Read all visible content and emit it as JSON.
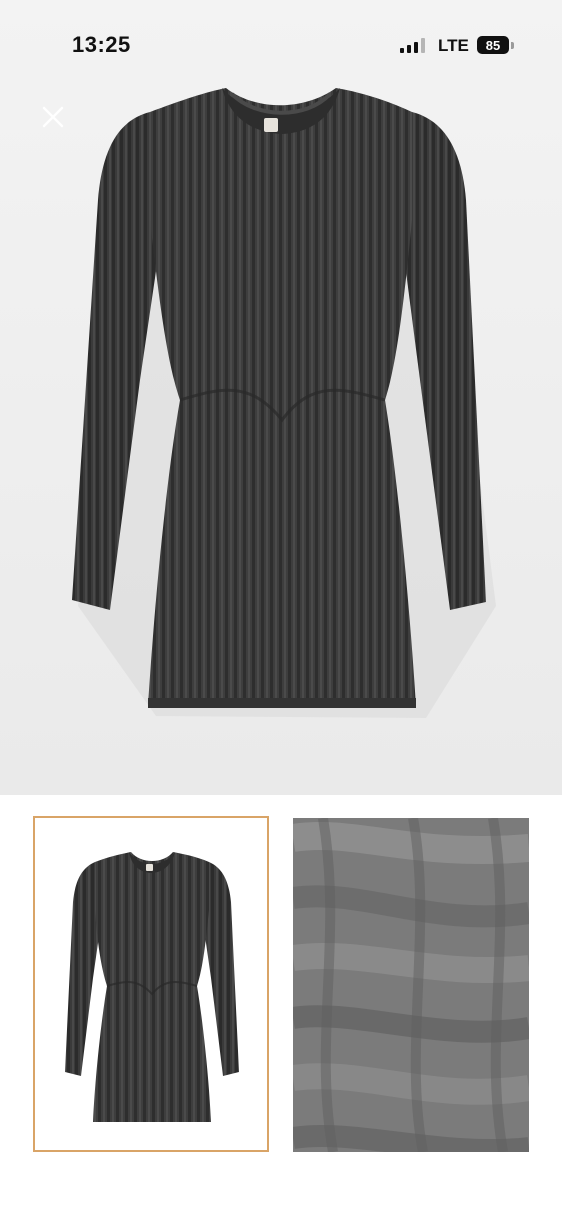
{
  "status_bar": {
    "time": "13:25",
    "network": "LTE",
    "battery": "85"
  },
  "hero": {
    "image": "knit-dress-product-image",
    "close_icon": "close-icon"
  },
  "thumbnails": [
    {
      "image": "knit-dress-thumbnail",
      "selected": true
    },
    {
      "image": "knit-texture-closeup-thumbnail",
      "selected": false
    }
  ],
  "colors": {
    "fabric": "#3d3d3d",
    "selected_border": "#d9a467"
  }
}
